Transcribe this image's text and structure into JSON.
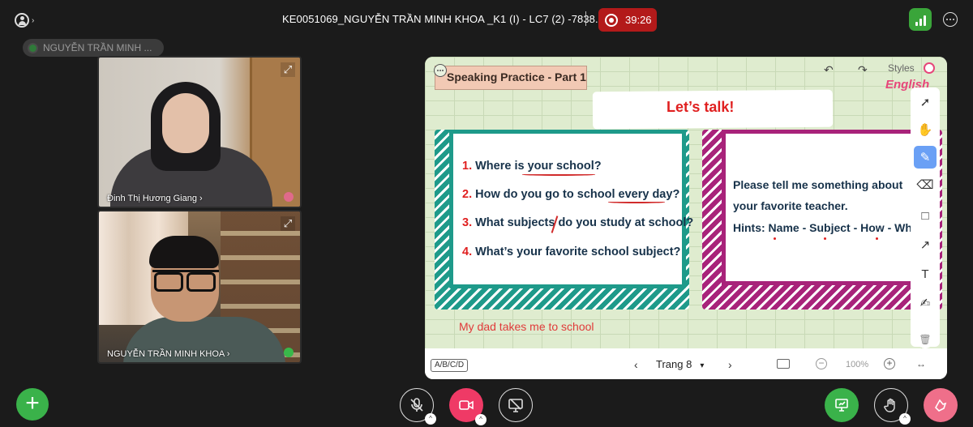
{
  "header": {
    "meeting_title": "KE0051069_NGUYỄN TRẦN MINH KHOA _K1 (I) - LC7 (2) -7838...",
    "recording_time": "39:26"
  },
  "speaker_chip": {
    "name": "NGUYỄN TRẦN MINH ..."
  },
  "tiles": [
    {
      "name": "Đinh Thị Hương Giang",
      "mic": "muted"
    },
    {
      "name": "NGUYỄN TRẦN MINH KHOA",
      "mic": "active"
    }
  ],
  "board": {
    "part_label": "Speaking Practice - Part 1",
    "styles_label": "Styles",
    "english_tag": "English",
    "heading": "Let’s talk!",
    "questions": [
      {
        "num": "1.",
        "text": "Where is your school?"
      },
      {
        "num": "2.",
        "text": "How do you go to school every day?"
      },
      {
        "num": "3.",
        "text": "What subjects do you study at school?"
      },
      {
        "num": "4.",
        "text": "What’s your favorite school subject?"
      }
    ],
    "prompt_lines": [
      "Please tell me something about",
      "your favorite teacher.",
      "Hints: Name - Subject - How - Wh"
    ],
    "handwritten_answer": "My dad takes me to school",
    "toolbar": [
      "pointer-icon",
      "hand-icon",
      "pen-icon",
      "eraser-icon",
      "rectangle-icon",
      "arrow-icon",
      "text-icon",
      "note-icon"
    ],
    "bottom": {
      "layout_label": "A/B/C/D",
      "page_label": "Trang 8",
      "zoom": "100%"
    }
  },
  "colors": {
    "record_red": "#b31a1a",
    "teal": "#1e9a8a",
    "magenta": "#a8237a",
    "accent_green": "#3ab24a",
    "accent_pink": "#ef3a66"
  }
}
